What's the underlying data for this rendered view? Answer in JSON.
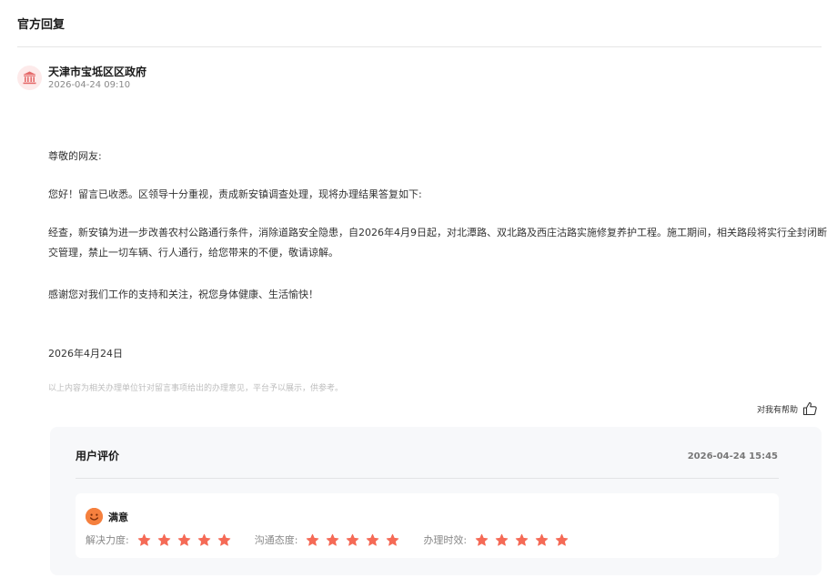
{
  "section": {
    "title": "官方回复"
  },
  "author": {
    "name": "天津市宝坻区区政府",
    "time": "2026-04-24 09:10",
    "icon": "government-building-icon"
  },
  "reply": {
    "greeting": "尊敬的网友:",
    "intro": "您好！留言已收悉。区领导十分重视，责成新安镇调查处理，现将办理结果答复如下:",
    "main": "经查，新安镇为进一步改善农村公路通行条件，消除道路安全隐患，自2026年4月9日起，对北潭路、双北路及西庄沽路实施修复养护工程。施工期间，相关路段将实行全封闭断交管理，禁止一切车辆、行人通行，给您带来的不便，敬请谅解。",
    "thanks": "感谢您对我们工作的支持和关注，祝您身体健康、生活愉快！",
    "date": "2026年4月24日"
  },
  "disclaimer": "以上内容为相关办理单位针对留言事项给出的办理意见，平台予以展示，供参考。",
  "helpful": {
    "label": "对我有帮助",
    "icon": "thumbs-up-icon"
  },
  "evaluation": {
    "title": "用户评价",
    "time": "2026-04-24 15:45",
    "satisfaction": "满意",
    "satisfaction_icon": "smile-face-icon",
    "metrics": [
      {
        "label": "解决力度:",
        "stars": 5
      },
      {
        "label": "沟通态度:",
        "stars": 5
      },
      {
        "label": "办理时效:",
        "stars": 5
      }
    ],
    "star_color": "#f56a56"
  },
  "colors": {
    "gov_icon": "#e56b6b",
    "gov_icon_bg": "#fdeaea",
    "smile_bg": "#f5803e"
  }
}
